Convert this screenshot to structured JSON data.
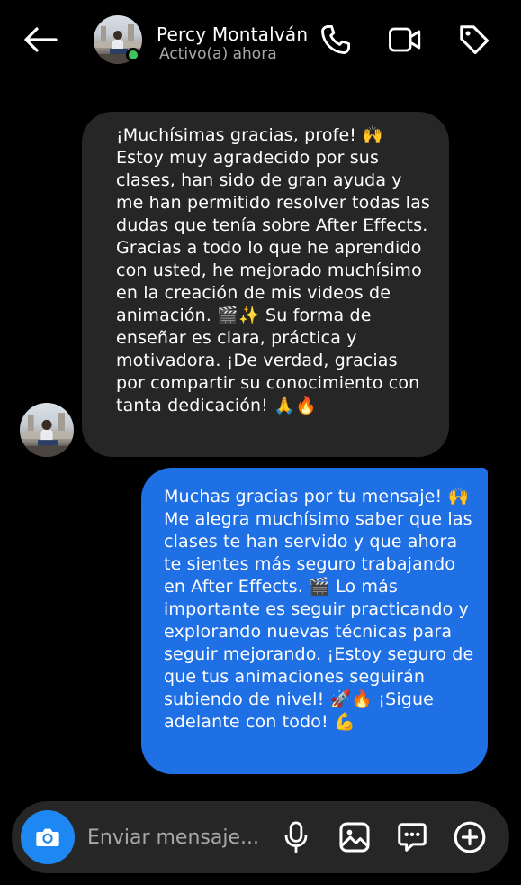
{
  "header": {
    "name": "Percy Montalván",
    "status": "Activo(a) ahora",
    "icons": [
      "back-arrow-icon",
      "phone-icon",
      "video-camera-icon",
      "tag-icon"
    ]
  },
  "messages": [
    {
      "direction": "incoming",
      "text": "¡Muchísimas gracias, profe! 🙌 Estoy muy agradecido por sus clases, han sido de gran ayuda y me han permitido resolver todas las dudas que tenía sobre After Effects. Gracias a todo lo que he aprendido con usted, he mejorado muchísimo en la creación de mis videos de animación. 🎬✨ Su forma de enseñar es clara, práctica y motivadora. ¡De verdad, gracias por compartir su conocimiento con tanta dedicación! 🙏🔥"
    },
    {
      "direction": "outgoing",
      "text": "Muchas gracias por tu mensaje! 🙌 Me alegra muchísimo saber que las clases te han servido y que ahora te sientes más seguro trabajando en After Effects. 🎬 Lo más importante es seguir practicando y explorando nuevas técnicas para seguir mejorando. ¡Estoy seguro de que tus animaciones seguirán subiendo de nivel! 🚀🔥 ¡Sigue adelante con todo! 💪"
    }
  ],
  "composer": {
    "placeholder": "Enviar mensaje...",
    "icons": [
      "camera-icon",
      "microphone-icon",
      "gallery-icon",
      "sticker-icon",
      "plus-icon"
    ]
  },
  "colors": {
    "background": "#000000",
    "incoming_bubble": "#262626",
    "outgoing_bubble": "#1f6fe5",
    "camera_button": "#1e88f2",
    "online_dot": "#3dc45a"
  }
}
